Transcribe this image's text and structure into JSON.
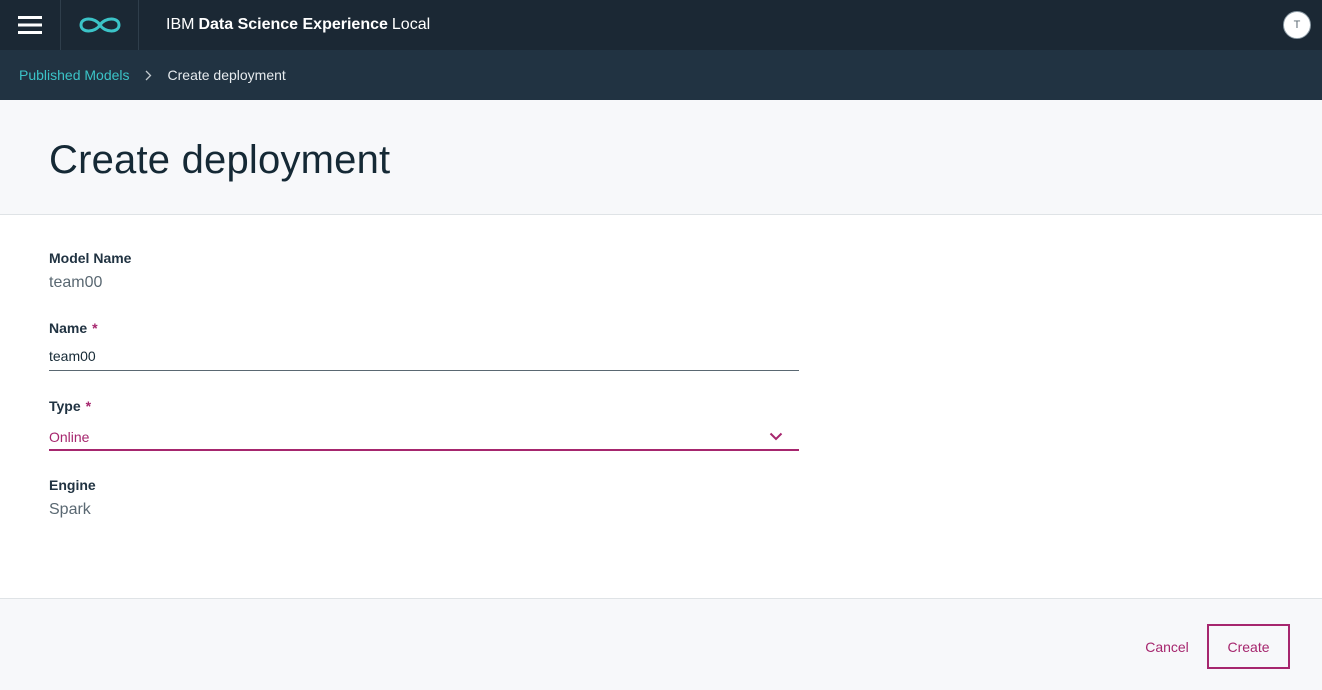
{
  "header": {
    "menu_icon": "hamburger-menu-icon",
    "logo_icon": "infinity-logo-icon",
    "brand_ibm": "IBM",
    "brand_product": "Data Science Experience",
    "brand_edition": "Local",
    "avatar_initial": "T"
  },
  "breadcrumb": {
    "parent_label": "Published Models",
    "separator_icon": "chevron-right-icon",
    "current_label": "Create deployment"
  },
  "page": {
    "title": "Create deployment"
  },
  "form": {
    "model_name": {
      "label": "Model Name",
      "value": "team00"
    },
    "name": {
      "label": "Name",
      "required_mark": "*",
      "value": "team00"
    },
    "type": {
      "label": "Type",
      "required_mark": "*",
      "selected": "Online",
      "icon": "chevron-down-icon"
    },
    "engine": {
      "label": "Engine",
      "value": "Spark"
    }
  },
  "actions": {
    "cancel_label": "Cancel",
    "create_label": "Create"
  },
  "colors": {
    "topbar": "#1b2834",
    "breadcrumb_bar": "#213342",
    "link_teal": "#3bc3c7",
    "accent_magenta": "#a6266e"
  }
}
